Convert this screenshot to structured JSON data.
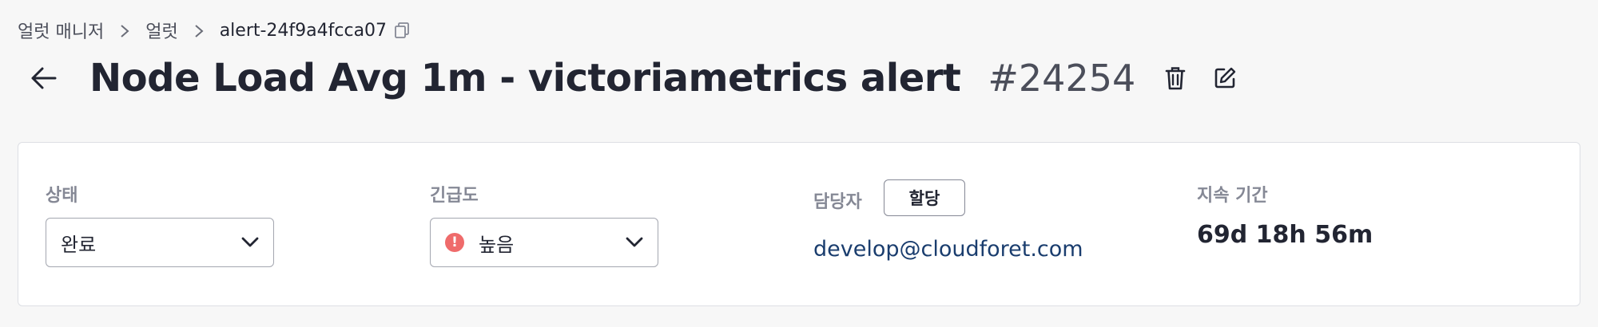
{
  "breadcrumb": {
    "items": [
      "얼럿 매니저",
      "얼럿",
      "alert-24f9a4fcca07"
    ]
  },
  "header": {
    "title": "Node Load Avg 1m - victoriametrics alert",
    "alert_number": "#24254"
  },
  "info": {
    "state": {
      "label": "상태",
      "value": "완료"
    },
    "urgency": {
      "label": "긴급도",
      "value": "높음",
      "badge_color": "#ef6b6b"
    },
    "assignee": {
      "label": "담당자",
      "assign_button": "할당",
      "email": "develop@cloudforet.com"
    },
    "duration": {
      "label": "지속 기간",
      "value": "69d 18h 56m"
    }
  },
  "colors": {
    "background": "#f7f7f7",
    "card": "#ffffff",
    "link": "#1a3d6e",
    "muted_label": "#858895"
  }
}
